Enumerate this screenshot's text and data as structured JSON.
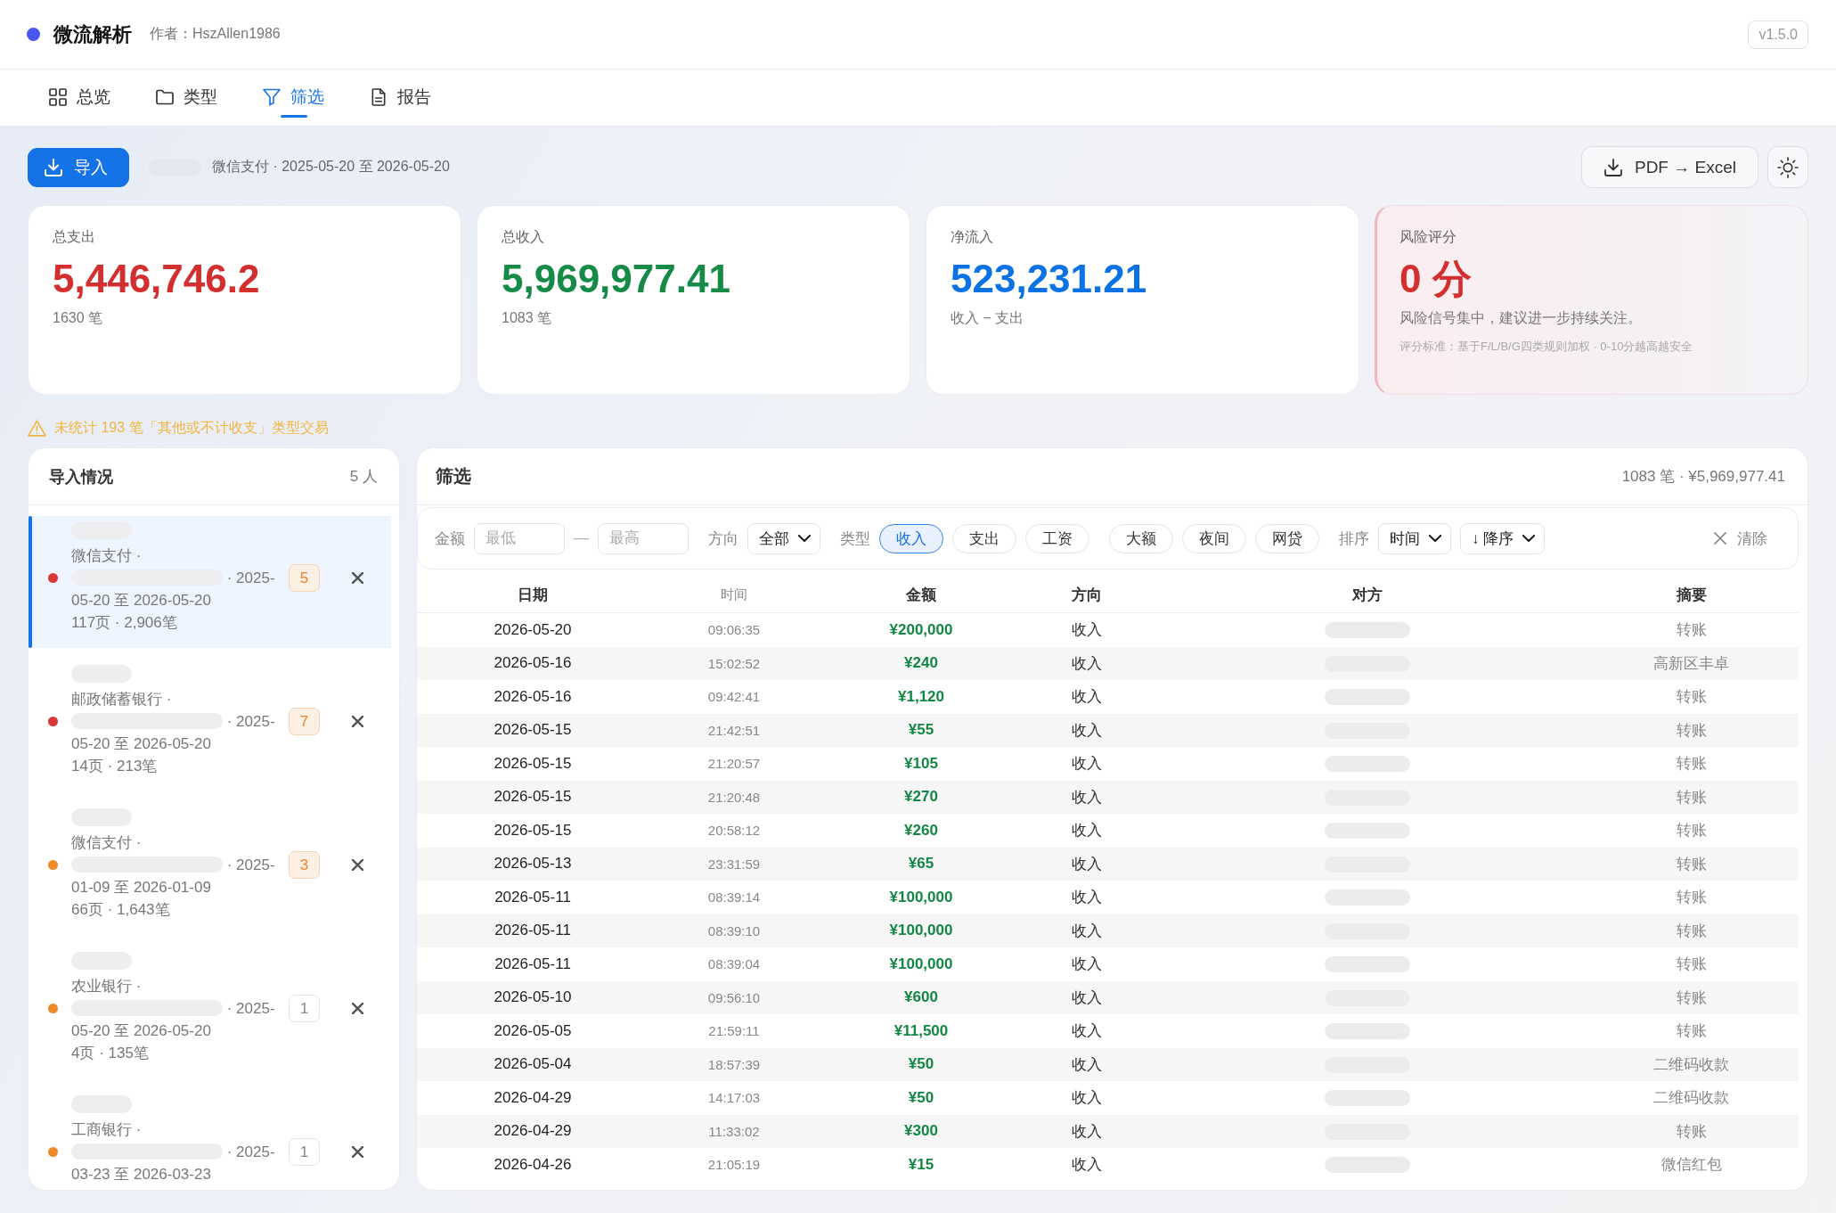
{
  "header": {
    "app_name": "微流解析",
    "author": "作者：HszAllen1986",
    "version": "v1.5.0"
  },
  "tabs": [
    {
      "label": "总览",
      "selected": false
    },
    {
      "label": "类型",
      "selected": false
    },
    {
      "label": "筛选",
      "selected": true
    },
    {
      "label": "报告",
      "selected": false
    }
  ],
  "toolbar": {
    "import_button": "导入",
    "source_summary": "微信支付 · 2025-05-20 至 2026-05-20",
    "convert_button": "PDF → Excel"
  },
  "stats": [
    {
      "kind": "metric",
      "label": "总支出",
      "value": "5,446,746.2",
      "sub": "1630 笔",
      "color": "#d32f2f"
    },
    {
      "kind": "metric",
      "label": "总收入",
      "value": "5,969,977.41",
      "sub": "1083 笔",
      "color": "#168a47"
    },
    {
      "kind": "metric",
      "label": "净流入",
      "value": "523,231.21",
      "sub": "收入 − 支出",
      "color": "#0b72e3"
    },
    {
      "kind": "risk",
      "label": "风险评分",
      "value": "0 分",
      "sub": "风险信号集中，建议进一步持续关注。",
      "note": "评分标准：基于F/L/B/G四类规则加权 · 0-10分越高越安全",
      "color": "#d32f2f"
    }
  ],
  "warning": "未统计 193 笔「其他或不计收支」类型交易",
  "imports": {
    "title": "导入情况",
    "count": "5 人",
    "items": [
      {
        "source": "微信支付 ·",
        "period": "· 2025-05-20 至 2026-05-20",
        "pages": "117页 · 2,906笔",
        "badge": "5",
        "badge_alert": true,
        "color": "#d93636",
        "selected": true
      },
      {
        "source": "邮政储蓄银行 ·",
        "period": "· 2025-05-20 至 2026-05-20",
        "pages": "14页 · 213笔",
        "badge": "7",
        "badge_alert": true,
        "color": "#d93636",
        "selected": false
      },
      {
        "source": "微信支付 ·",
        "period": "· 2025-01-09 至 2026-01-09",
        "pages": "66页 · 1,643笔",
        "badge": "3",
        "badge_alert": true,
        "color": "#ec8a2c",
        "selected": false
      },
      {
        "source": "农业银行 ·",
        "period": "· 2025-05-20 至 2026-05-20",
        "pages": "4页 · 135笔",
        "badge": "1",
        "badge_alert": false,
        "color": "#ec8a2c",
        "selected": false
      },
      {
        "source": "工商银行 ·",
        "period": "· 2025-03-23 至 2026-03-23",
        "badge": "1",
        "badge_alert": false,
        "color": "#ec8a2c",
        "selected": false
      }
    ]
  },
  "filter_panel": {
    "title": "筛选",
    "summary": "1083 笔 · ¥5,969,977.41",
    "filters": {
      "amount": {
        "label": "金额",
        "min_placeholder": "最低",
        "separator": "—",
        "max_placeholder": "最高"
      },
      "direction": {
        "label": "方向",
        "value": "全部"
      },
      "type": {
        "label": "类型",
        "options": [
          {
            "label": "收入",
            "selected": true
          },
          {
            "label": "支出",
            "selected": false
          },
          {
            "label": "工资",
            "selected": false
          }
        ]
      },
      "tags": [
        {
          "label": "大额",
          "selected": false
        },
        {
          "label": "夜间",
          "selected": false
        },
        {
          "label": "网贷",
          "selected": false
        }
      ],
      "sort": {
        "label": "排序",
        "field": "时间",
        "order": "↓ 降序"
      },
      "clear_button": "清除"
    },
    "table": {
      "columns": [
        {
          "label": "日期",
          "kind": "date"
        },
        {
          "label": "时间",
          "kind": "time"
        },
        {
          "label": "金额",
          "kind": "amount"
        },
        {
          "label": "方向",
          "kind": "direction"
        },
        {
          "label": "对方",
          "kind": "party"
        },
        {
          "label": "摘要",
          "kind": "summary"
        }
      ],
      "rows": [
        {
          "kind": "income",
          "date": "2026-05-20",
          "time": "09:06:35",
          "amount": "¥200,000",
          "direction": "收入",
          "summary": "转账"
        },
        {
          "kind": "income",
          "date": "2026-05-16",
          "time": "15:02:52",
          "amount": "¥240",
          "direction": "收入",
          "summary": "高新区丰卓"
        },
        {
          "kind": "income",
          "date": "2026-05-16",
          "time": "09:42:41",
          "amount": "¥1,120",
          "direction": "收入",
          "summary": "转账"
        },
        {
          "kind": "income",
          "date": "2026-05-15",
          "time": "21:42:51",
          "amount": "¥55",
          "direction": "收入",
          "summary": "转账"
        },
        {
          "kind": "income",
          "date": "2026-05-15",
          "time": "21:20:57",
          "amount": "¥105",
          "direction": "收入",
          "summary": "转账"
        },
        {
          "kind": "income",
          "date": "2026-05-15",
          "time": "21:20:48",
          "amount": "¥270",
          "direction": "收入",
          "summary": "转账"
        },
        {
          "kind": "income",
          "date": "2026-05-15",
          "time": "20:58:12",
          "amount": "¥260",
          "direction": "收入",
          "summary": "转账"
        },
        {
          "kind": "income",
          "date": "2026-05-13",
          "time": "23:31:59",
          "amount": "¥65",
          "direction": "收入",
          "summary": "转账"
        },
        {
          "kind": "income",
          "date": "2026-05-11",
          "time": "08:39:14",
          "amount": "¥100,000",
          "direction": "收入",
          "summary": "转账"
        },
        {
          "kind": "income",
          "date": "2026-05-11",
          "time": "08:39:10",
          "amount": "¥100,000",
          "direction": "收入",
          "summary": "转账"
        },
        {
          "kind": "income",
          "date": "2026-05-11",
          "time": "08:39:04",
          "amount": "¥100,000",
          "direction": "收入",
          "summary": "转账"
        },
        {
          "kind": "income",
          "date": "2026-05-10",
          "time": "09:56:10",
          "amount": "¥600",
          "direction": "收入",
          "summary": "转账"
        },
        {
          "kind": "income",
          "date": "2026-05-05",
          "time": "21:59:11",
          "amount": "¥11,500",
          "direction": "收入",
          "summary": "转账"
        },
        {
          "kind": "income",
          "date": "2026-05-04",
          "time": "18:57:39",
          "amount": "¥50",
          "direction": "收入",
          "summary": "二维码收款"
        },
        {
          "kind": "income",
          "date": "2026-04-29",
          "time": "14:17:03",
          "amount": "¥50",
          "direction": "收入",
          "summary": "二维码收款"
        },
        {
          "kind": "income",
          "date": "2026-04-29",
          "time": "11:33:02",
          "amount": "¥300",
          "direction": "收入",
          "summary": "转账"
        },
        {
          "kind": "income",
          "date": "2026-04-26",
          "time": "21:05:19",
          "amount": "¥15",
          "direction": "收入",
          "summary": "微信红包"
        }
      ]
    }
  }
}
